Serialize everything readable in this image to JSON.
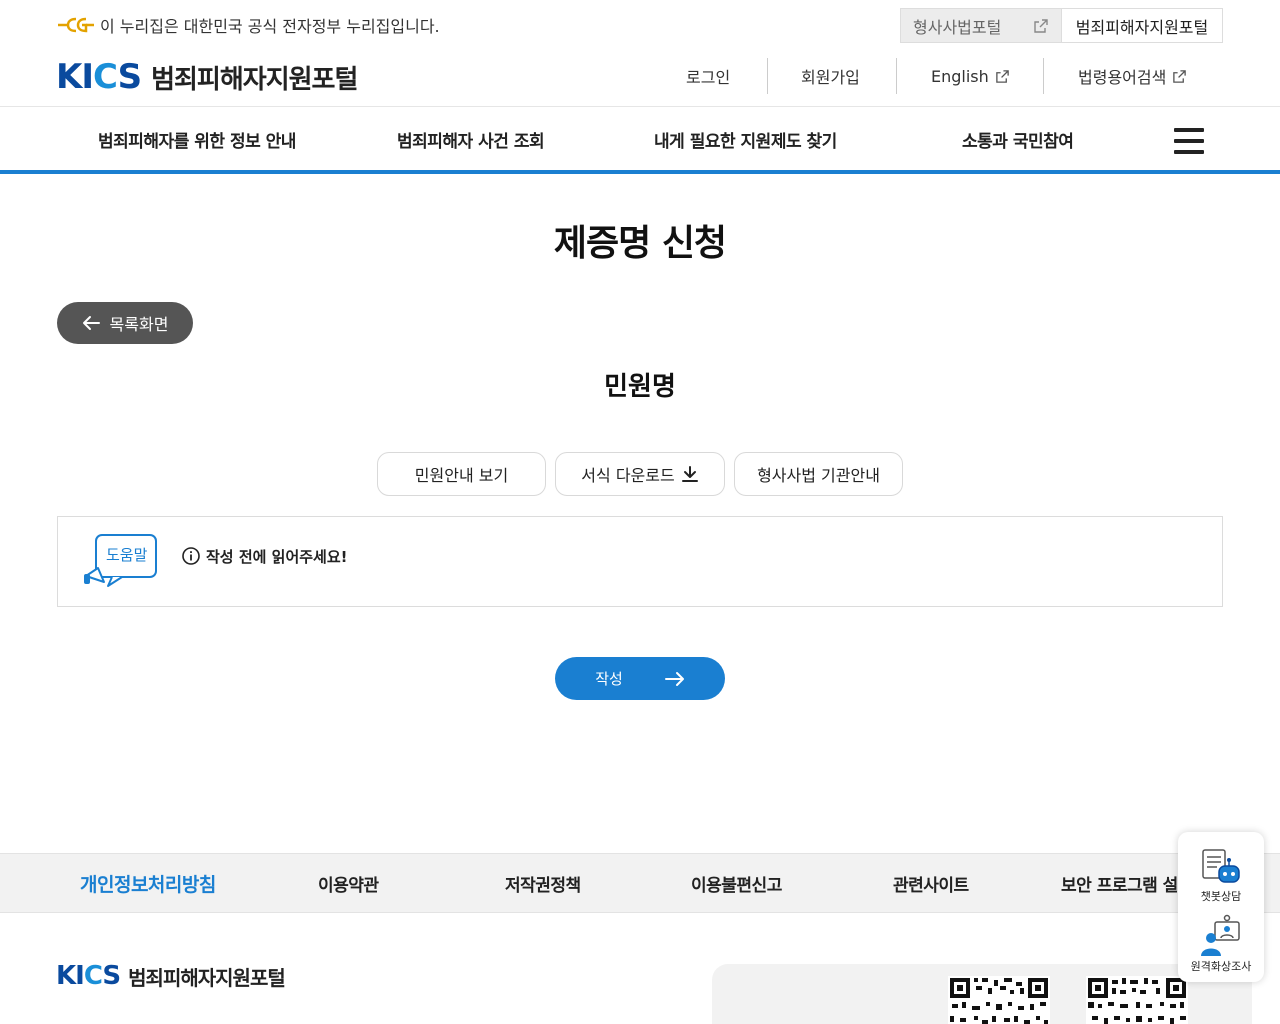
{
  "gov_banner": {
    "text": "이 누리집은 대한민국 공식 전자정부 누리집입니다."
  },
  "portal_tabs": [
    {
      "label": "형사사법포털"
    },
    {
      "label": "범죄피해자지원포털"
    }
  ],
  "logo": {
    "mark": "KICS",
    "name": "범죄피해자지원포털"
  },
  "util_menu": {
    "login": "로그인",
    "signup": "회원가입",
    "english": "English",
    "law_search": "법령용어검색"
  },
  "gnb": [
    {
      "label": "범죄피해자를 위한 정보 안내"
    },
    {
      "label": "범죄피해자 사건 조회"
    },
    {
      "label": "내게 필요한 지원제도 찾기"
    },
    {
      "label": "소통과 국민참여"
    }
  ],
  "page": {
    "title": "제증명 신청",
    "back_label": "목록화면",
    "sub_title": "민원명",
    "buttons": {
      "guide": "민원안내 보기",
      "download": "서식 다운로드",
      "agency": "형사사법 기관안내"
    },
    "help": {
      "badge": "도움말",
      "notice": "작성 전에 읽어주세요!"
    },
    "write_label": "작성"
  },
  "footer": {
    "links": [
      {
        "label": "개인정보처리방침"
      },
      {
        "label": "이용약관"
      },
      {
        "label": "저작권정책"
      },
      {
        "label": "이용불편신고"
      },
      {
        "label": "관련사이트"
      },
      {
        "label": "보안 프로그램 설치"
      }
    ],
    "logo_name": "범죄피해자지원포털"
  },
  "quick_menu": {
    "chatbot": "챗봇상담",
    "video": "원격화상조사"
  },
  "colors": {
    "primary": "#1a7fd1",
    "brand": "#0a4a9e",
    "dark_button": "#555555"
  }
}
